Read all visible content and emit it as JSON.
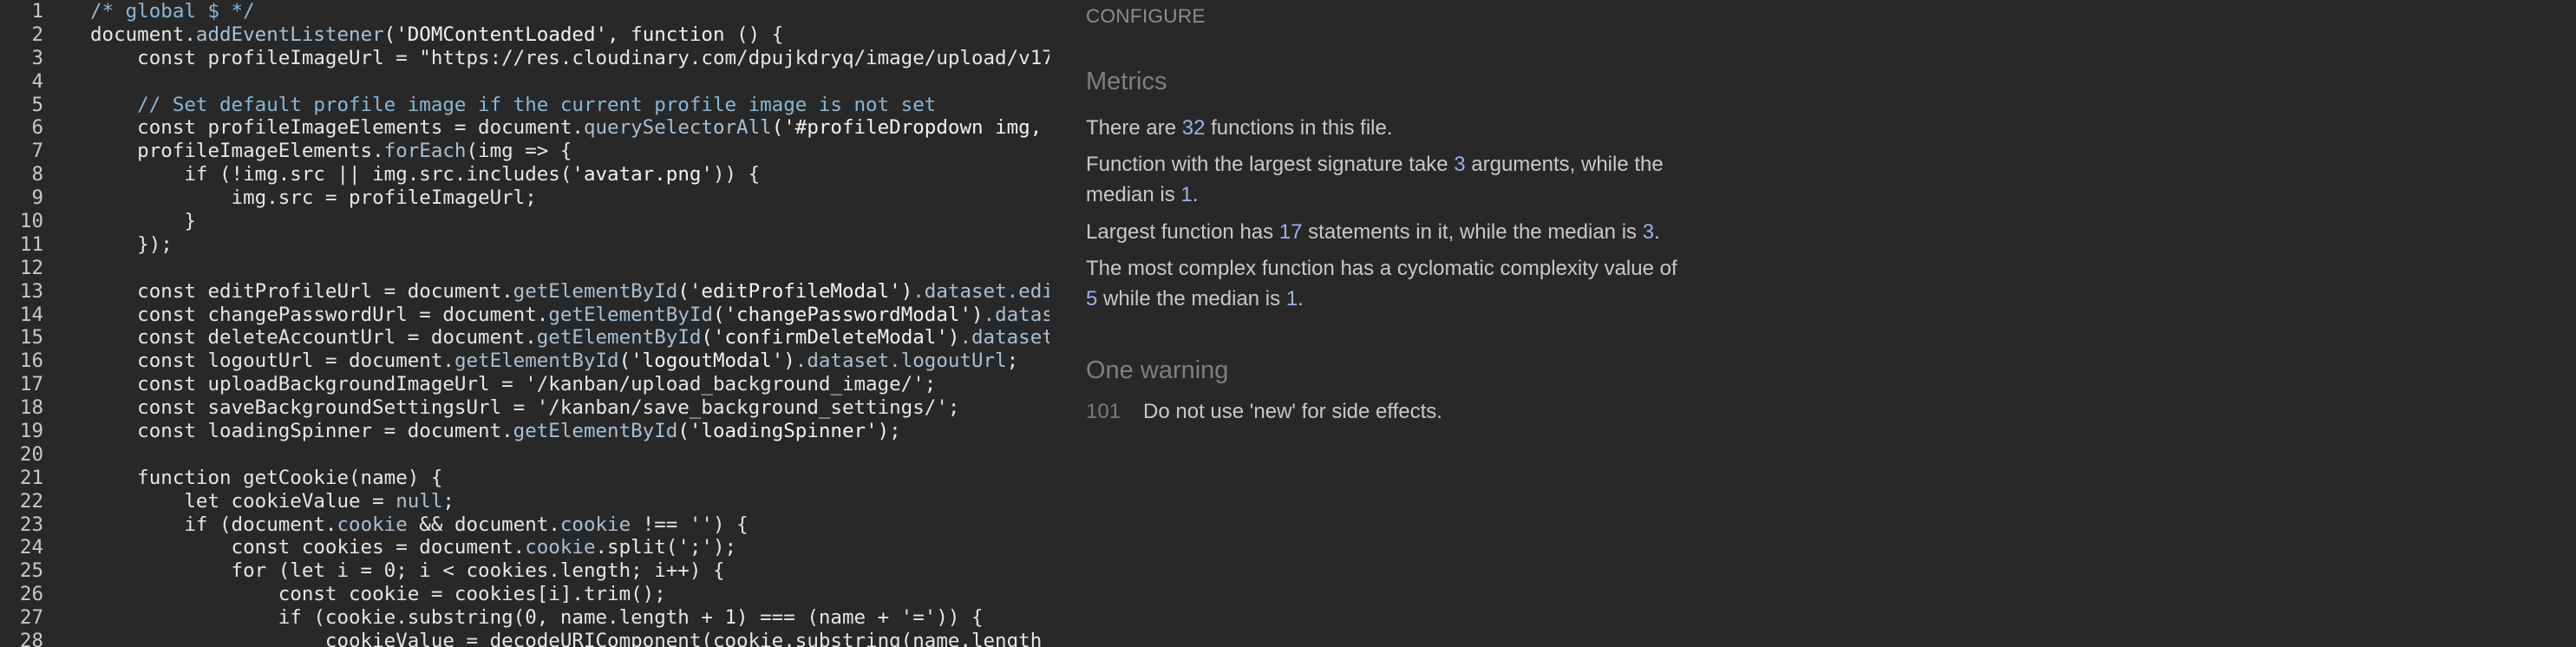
{
  "editor": {
    "lines": [
      {
        "n": "1",
        "tokens": [
          {
            "t": "/* global $ */",
            "c": "comment"
          }
        ]
      },
      {
        "n": "2",
        "tokens": [
          {
            "t": "document.",
            "c": "plain"
          },
          {
            "t": "addEventListener",
            "c": "prop"
          },
          {
            "t": "('DOMContentLoaded', ",
            "c": "string"
          },
          {
            "t": "function",
            "c": "keyword"
          },
          {
            "t": " () {",
            "c": "plain"
          }
        ]
      },
      {
        "n": "3",
        "tokens": [
          {
            "t": "    const profileImageUrl = \"https://res.cloudinary.com/dpujkdryq/image/upload/v17",
            "c": "plain"
          }
        ]
      },
      {
        "n": "4",
        "tokens": []
      },
      {
        "n": "5",
        "tokens": [
          {
            "t": "    // Set default profile image if the current profile image is not set",
            "c": "comment"
          }
        ]
      },
      {
        "n": "6",
        "tokens": [
          {
            "t": "    const profileImageElements = document.",
            "c": "plain"
          },
          {
            "t": "querySelectorAll",
            "c": "prop"
          },
          {
            "t": "('#profileDropdown img, i",
            "c": "string"
          }
        ]
      },
      {
        "n": "7",
        "tokens": [
          {
            "t": "    profileImageElements.",
            "c": "plain"
          },
          {
            "t": "forEach",
            "c": "prop"
          },
          {
            "t": "(img => {",
            "c": "plain"
          }
        ]
      },
      {
        "n": "8",
        "tokens": [
          {
            "t": "        if (!img.src || img.src.includes(",
            "c": "plain"
          },
          {
            "t": "'avatar.png'",
            "c": "string"
          },
          {
            "t": ")) {",
            "c": "plain"
          }
        ]
      },
      {
        "n": "9",
        "tokens": [
          {
            "t": "            img.src = profileImageUrl;",
            "c": "plain"
          }
        ]
      },
      {
        "n": "10",
        "tokens": [
          {
            "t": "        }",
            "c": "plain"
          }
        ]
      },
      {
        "n": "11",
        "tokens": [
          {
            "t": "    });",
            "c": "plain"
          }
        ]
      },
      {
        "n": "12",
        "tokens": []
      },
      {
        "n": "13",
        "tokens": [
          {
            "t": "    const editProfileUrl = document.",
            "c": "plain"
          },
          {
            "t": "getElementById",
            "c": "prop"
          },
          {
            "t": "('editProfileModal')",
            "c": "string"
          },
          {
            "t": ".dataset.edit",
            "c": "prop"
          }
        ]
      },
      {
        "n": "14",
        "tokens": [
          {
            "t": "    const changePasswordUrl = document.",
            "c": "plain"
          },
          {
            "t": "getElementById",
            "c": "prop"
          },
          {
            "t": "('changePasswordModal')",
            "c": "string"
          },
          {
            "t": ".datase",
            "c": "prop"
          }
        ]
      },
      {
        "n": "15",
        "tokens": [
          {
            "t": "    const deleteAccountUrl = document.",
            "c": "plain"
          },
          {
            "t": "getElementById",
            "c": "prop"
          },
          {
            "t": "('confirmDeleteModal')",
            "c": "string"
          },
          {
            "t": ".dataset",
            "c": "prop"
          }
        ]
      },
      {
        "n": "16",
        "tokens": [
          {
            "t": "    const logoutUrl = document.",
            "c": "plain"
          },
          {
            "t": "getElementById",
            "c": "prop"
          },
          {
            "t": "('logoutModal')",
            "c": "string"
          },
          {
            "t": ".dataset.logoutUrl",
            "c": "prop"
          },
          {
            "t": ";",
            "c": "plain"
          }
        ]
      },
      {
        "n": "17",
        "tokens": [
          {
            "t": "    const uploadBackgroundImageUrl = '/kanban/upload_background_image/';",
            "c": "plain"
          }
        ]
      },
      {
        "n": "18",
        "tokens": [
          {
            "t": "    const saveBackgroundSettingsUrl = '/kanban/save_background_settings/';",
            "c": "plain"
          }
        ]
      },
      {
        "n": "19",
        "tokens": [
          {
            "t": "    const loadingSpinner = document.",
            "c": "plain"
          },
          {
            "t": "getElementById",
            "c": "prop"
          },
          {
            "t": "('loadingSpinner')",
            "c": "string"
          },
          {
            "t": ";",
            "c": "plain"
          }
        ]
      },
      {
        "n": "20",
        "tokens": []
      },
      {
        "n": "21",
        "tokens": [
          {
            "t": "    function getCookie(name) {",
            "c": "plain"
          }
        ]
      },
      {
        "n": "22",
        "tokens": [
          {
            "t": "        let cookieValue = ",
            "c": "plain"
          },
          {
            "t": "null",
            "c": "prop"
          },
          {
            "t": ";",
            "c": "plain"
          }
        ]
      },
      {
        "n": "23",
        "tokens": [
          {
            "t": "        if (document.",
            "c": "plain"
          },
          {
            "t": "cookie",
            "c": "prop"
          },
          {
            "t": " && document.",
            "c": "plain"
          },
          {
            "t": "cookie",
            "c": "prop"
          },
          {
            "t": " !== '') {",
            "c": "plain"
          }
        ]
      },
      {
        "n": "24",
        "tokens": [
          {
            "t": "            const cookies = document.",
            "c": "plain"
          },
          {
            "t": "cookie",
            "c": "prop"
          },
          {
            "t": ".split(';');",
            "c": "plain"
          }
        ]
      },
      {
        "n": "25",
        "tokens": [
          {
            "t": "            for (let i = 0; i < cookies.length; i++) {",
            "c": "plain"
          }
        ]
      },
      {
        "n": "26",
        "tokens": [
          {
            "t": "                const cookie = cookies[i].trim();",
            "c": "plain"
          }
        ]
      },
      {
        "n": "27",
        "tokens": [
          {
            "t": "                if (cookie.substring(0, name.length + 1) === (name + '=')) {",
            "c": "plain"
          }
        ]
      },
      {
        "n": "28",
        "tokens": [
          {
            "t": "                    cookieValue = decodeURIComponent(cookie.substring(name.length",
            "c": "plain"
          }
        ]
      }
    ]
  },
  "panel": {
    "configure_label": "CONFIGURE",
    "metrics_title": "Metrics",
    "metrics": {
      "functions_count": {
        "pre": "There are ",
        "num": "32",
        "post": " functions in this file."
      },
      "signature": {
        "pre": "Function with the largest signature take ",
        "num1": "3",
        "mid": " arguments, while the median is ",
        "num2": "1",
        "post": "."
      },
      "statements": {
        "pre": "Largest function has ",
        "num1": "17",
        "mid": " statements in it, while the median is ",
        "num2": "3",
        "post": "."
      },
      "complexity": {
        "pre": "The most complex function has a cyclomatic complexity value of ",
        "num1": "5",
        "mid": " while the median is ",
        "num2": "1",
        "post": "."
      }
    },
    "warnings_title": "One warning",
    "warnings": [
      {
        "line": "101",
        "message": "Do not use 'new' for side effects."
      }
    ]
  },
  "colors": {
    "background": "#282828",
    "number_accent": "#96b4e6",
    "comment": "#8ab6d6"
  }
}
